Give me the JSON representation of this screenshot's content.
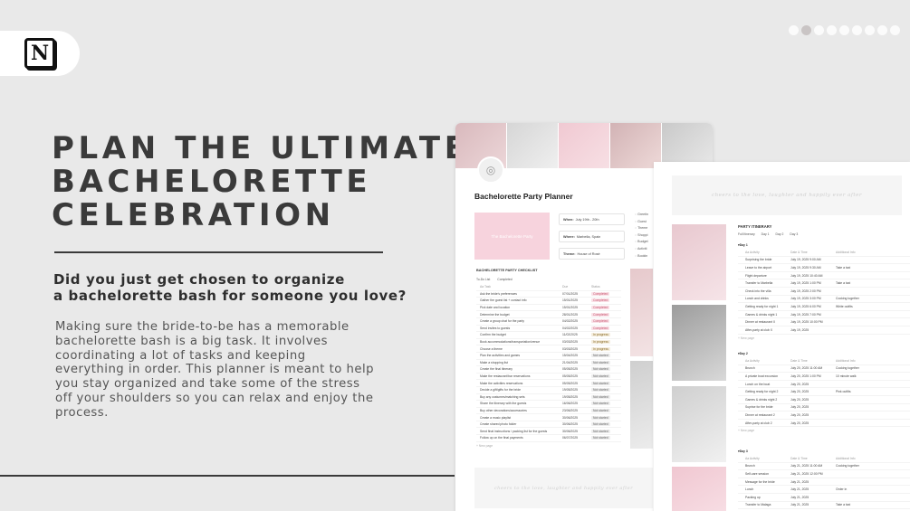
{
  "brand": {
    "logo_letter": "N"
  },
  "carousel": {
    "count": 9,
    "active_index": 1
  },
  "hero": {
    "headline_lines": [
      "PLAN THE ULTIMATE",
      "BACHELORETTE",
      "CELEBRATION"
    ],
    "subhead_lines": [
      "Did you just get chosen to organize",
      "a bachelorette bash for someone you love?"
    ],
    "body_lines": [
      "Making sure the bride-to-be has a memorable",
      "bachelorette bash is a big task. It involves",
      "coordinating a lot of tasks and keeping",
      "everything in order. This planner is meant to help",
      "you stay organized and take some of the stress",
      "off your shoulders so you can relax and enjoy the",
      "process."
    ]
  },
  "planner": {
    "title": "Bachelorette Party Planner",
    "card_text": "The Bachelorette Party",
    "chips": [
      {
        "label": "When:",
        "value": "July 19th - 20th"
      },
      {
        "label": "Where:",
        "value": "Marbella, Spain"
      },
      {
        "label": "Theme:",
        "value": "House of Rosé"
      }
    ],
    "side_links": [
      "Greetin",
      "Guest",
      "Theme",
      "Shoppi",
      "Budget",
      "Activiti",
      "Bookin"
    ],
    "checklist_title": "BACHELORETTE PARTY CHECKLIST",
    "checklist_tabs": [
      "To-Do List",
      "Completed"
    ],
    "checklist_columns": [
      "Aa Task",
      "Due",
      "Status"
    ],
    "new_label": "+ New page",
    "tasks": [
      {
        "task": "Ask the bride's preferences",
        "due": "07/01/2025",
        "status": "Completed"
      },
      {
        "task": "Gather the guest list + contact info",
        "due": "15/01/2025",
        "status": "Completed"
      },
      {
        "task": "Pick date and location",
        "due": "15/01/2025",
        "status": "Completed"
      },
      {
        "task": "Determine the budget",
        "due": "28/01/2025",
        "status": "Completed"
      },
      {
        "task": "Create a group chat for the party",
        "due": "04/02/2025",
        "status": "Completed"
      },
      {
        "task": "Send invites to guests",
        "due": "04/02/2025",
        "status": "Completed"
      },
      {
        "task": "Confirm the budget",
        "due": "11/02/2025",
        "status": "In progress"
      },
      {
        "task": "Book accommodations/transportation/venue",
        "due": "03/03/2025",
        "status": "In progress"
      },
      {
        "task": "Choose a theme",
        "due": "03/03/2025",
        "status": "In progress"
      },
      {
        "task": "Plan the activities and games",
        "due": "15/04/2025",
        "status": "Not started"
      },
      {
        "task": "Make a shopping list",
        "due": "21/04/2025",
        "status": "Not started"
      },
      {
        "task": "Create the final itinerary",
        "due": "05/05/2025",
        "status": "Not started"
      },
      {
        "task": "Make the restaurant/bar reservations",
        "due": "05/05/2025",
        "status": "Not started"
      },
      {
        "task": "Make the activities reservations",
        "due": "05/05/2025",
        "status": "Not started"
      },
      {
        "task": "Decide a gift/gifts for the bride",
        "due": "19/05/2025",
        "status": "Not started"
      },
      {
        "task": "Buy any costumes/matching sets",
        "due": "19/05/2025",
        "status": "Not started"
      },
      {
        "task": "Share the itinerary with the guests",
        "due": "16/06/2025",
        "status": "Not started"
      },
      {
        "task": "Buy other decorations/accessories",
        "due": "23/06/2025",
        "status": "Not started"
      },
      {
        "task": "Create a music playlist",
        "due": "30/06/2025",
        "status": "Not started"
      },
      {
        "task": "Create shared photo folder",
        "due": "30/06/2025",
        "status": "Not started"
      },
      {
        "task": "Send final instructions / packing list for the guests",
        "due": "30/06/2025",
        "status": "Not started"
      },
      {
        "task": "Follow up on the final payments",
        "due": "06/07/2025",
        "status": "Not started"
      }
    ],
    "banner_text": "cheers to the love, laughter and happily ever after"
  },
  "itinerary": {
    "banner_text": "cheers to the love, laughter and happily ever after",
    "title": "PARTY ITINERARY",
    "tabs": [
      "Full Itinerary",
      "Day 1",
      "Day 2",
      "Day 3"
    ],
    "columns": [
      "Aa Activity",
      "Date & Time",
      "Additional Info"
    ],
    "new_label": "+ New page",
    "days": [
      {
        "label": "Day 1",
        "rows": [
          {
            "activity": "Surprising the bride",
            "time": "July 19, 2025 9:00 AM",
            "info": ""
          },
          {
            "activity": "Leave to the airport",
            "time": "July 19, 2025 9:30 AM",
            "info": "Take a taxi"
          },
          {
            "activity": "Flight departure",
            "time": "July 19, 2025 10:40 AM",
            "info": ""
          },
          {
            "activity": "Transfer to Marbella",
            "time": "July 19, 2025 1:00 PM",
            "info": "Take a taxi"
          },
          {
            "activity": "Check into the villa",
            "time": "July 19, 2025 2:00 PM",
            "info": ""
          },
          {
            "activity": "Lunch and drinks",
            "time": "July 19, 2025 3:00 PM",
            "info": "Cooking together"
          },
          {
            "activity": "Getting ready for night 1",
            "time": "July 19, 2025 6:00 PM",
            "info": "White outfits"
          },
          {
            "activity": "Games & drinks night 1",
            "time": "July 19, 2025 7:00 PM",
            "info": ""
          },
          {
            "activity": "Dinner at restaurant X",
            "time": "July 19, 2025 10:00 PM",
            "info": ""
          },
          {
            "activity": "After-party at club X",
            "time": "July 19, 2025",
            "info": ""
          }
        ]
      },
      {
        "label": "Day 2",
        "rows": [
          {
            "activity": "Brunch",
            "time": "July 20, 2025 11:00 AM",
            "info": "Cooking together"
          },
          {
            "activity": "A private boat excursion",
            "time": "July 20, 2025 1:00 PM",
            "info": "10 minute walk"
          },
          {
            "activity": "Lunch on the boat",
            "time": "July 20, 2025",
            "info": ""
          },
          {
            "activity": "Getting ready for night 2",
            "time": "July 20, 2025",
            "info": "Pink outfits"
          },
          {
            "activity": "Games & drinks night 2",
            "time": "July 20, 2025",
            "info": ""
          },
          {
            "activity": "Suprise for the bride",
            "time": "July 20, 2025",
            "info": ""
          },
          {
            "activity": "Dinner at restaurant 2",
            "time": "July 20, 2025",
            "info": ""
          },
          {
            "activity": "After-party at club 2",
            "time": "July 20, 2025",
            "info": ""
          }
        ]
      },
      {
        "label": "Day 3",
        "rows": [
          {
            "activity": "Brunch",
            "time": "July 21, 2025 11:00 AM",
            "info": "Cooking together"
          },
          {
            "activity": "Self-care session",
            "time": "July 21, 2025 12:00 PM",
            "info": ""
          },
          {
            "activity": "Message for the bride",
            "time": "July 21, 2025",
            "info": ""
          },
          {
            "activity": "Lunch",
            "time": "July 21, 2025",
            "info": "Order in"
          },
          {
            "activity": "Packing up",
            "time": "July 21, 2025",
            "info": ""
          },
          {
            "activity": "Transfer to Malaga",
            "time": "July 21, 2025",
            "info": "Take a taxi"
          }
        ]
      }
    ]
  }
}
